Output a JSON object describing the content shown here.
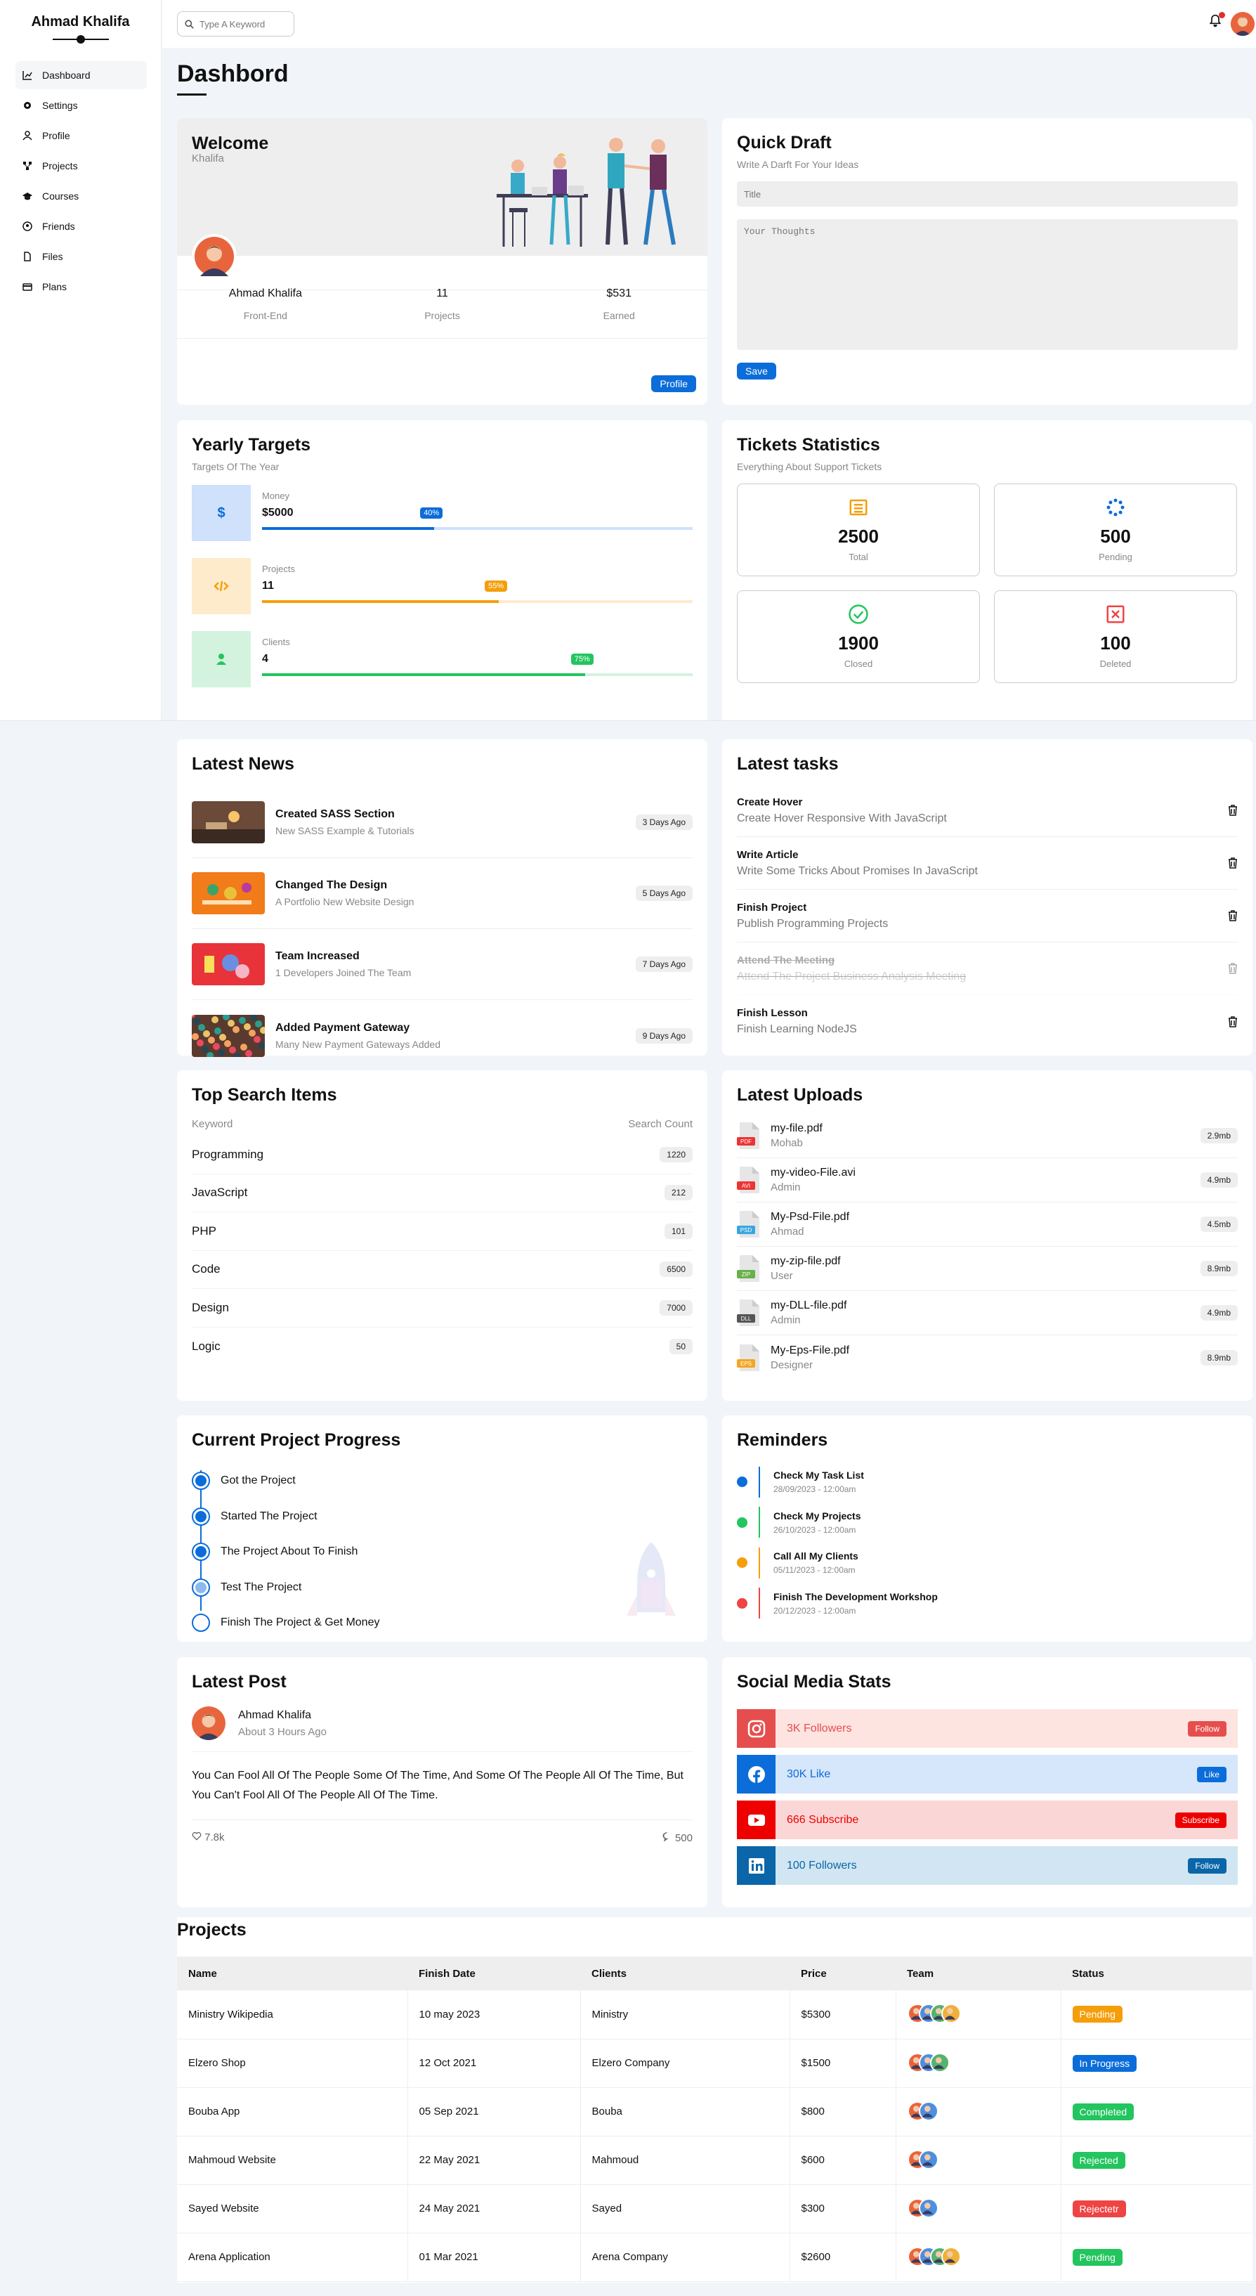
{
  "sidebar": {
    "brand": "Ahmad Khalifa",
    "items": [
      {
        "label": "Dashboard",
        "icon": "chart-icon"
      },
      {
        "label": "Settings",
        "icon": "gear-icon"
      },
      {
        "label": "Profile",
        "icon": "user-icon"
      },
      {
        "label": "Projects",
        "icon": "diagram-icon"
      },
      {
        "label": "Courses",
        "icon": "graduation-cap-icon"
      },
      {
        "label": "Friends",
        "icon": "circle-user-icon"
      },
      {
        "label": "Files",
        "icon": "file-icon"
      },
      {
        "label": "Plans",
        "icon": "credit-card-icon"
      }
    ]
  },
  "topbar": {
    "search_placeholder": "Type A Keyword"
  },
  "page": {
    "title": "Dashbord"
  },
  "welcome": {
    "title": "Welcome",
    "name": "Khalifa",
    "stats": [
      {
        "value": "Ahmad Khalifa",
        "label": "Front-End"
      },
      {
        "value": "11",
        "label": "Projects"
      },
      {
        "value": "$531",
        "label": "Earned"
      }
    ],
    "button": "Profile"
  },
  "draft": {
    "title": "Quick Draft",
    "subtitle": "Write A Darft For Your Ideas",
    "title_placeholder": "Title",
    "body_placeholder": "Your Thoughts",
    "button": "Save"
  },
  "targets": {
    "title": "Yearly Targets",
    "subtitle": "Targets Of The Year",
    "items": [
      {
        "label": "Money",
        "value": "$5000",
        "percent": 40,
        "percent_label": "40%",
        "color": "#0b6dd9",
        "bg": "#cfe1fb",
        "icon": "dollar-icon"
      },
      {
        "label": "Projects",
        "value": "11",
        "percent": 55,
        "percent_label": "55%",
        "color": "#f59e0b",
        "bg": "#fdebcc",
        "icon": "code-icon"
      },
      {
        "label": "Clients",
        "value": "4",
        "percent": 75,
        "percent_label": "75%",
        "color": "#22c55e",
        "bg": "#d3f3df",
        "icon": "user-icon"
      }
    ]
  },
  "tickets": {
    "title": "Tickets Statistics",
    "subtitle": "Everything About Support Tickets",
    "items": [
      {
        "value": "2500",
        "label": "Total",
        "icon": "list-icon",
        "color": "#f59e0b"
      },
      {
        "value": "500",
        "label": "Pending",
        "icon": "spinner-icon",
        "color": "#0b6dd9"
      },
      {
        "value": "1900",
        "label": "Closed",
        "icon": "check-circle-icon",
        "color": "#22c55e"
      },
      {
        "value": "100",
        "label": "Deleted",
        "icon": "x-square-icon",
        "color": "#ef4444"
      }
    ]
  },
  "news": {
    "title": "Latest News",
    "items": [
      {
        "title": "Created SASS Section",
        "desc": "New SASS Example & Tutorials",
        "time": "3 Days Ago"
      },
      {
        "title": "Changed The Design",
        "desc": "A Portfolio New Website Design",
        "time": "5 Days Ago"
      },
      {
        "title": "Team Increased",
        "desc": "1 Developers Joined The Team",
        "time": "7 Days Ago"
      },
      {
        "title": "Added Payment Gateway",
        "desc": "Many New Payment Gateways Added",
        "time": "9 Days Ago"
      }
    ]
  },
  "tasks": {
    "title": "Latest tasks",
    "items": [
      {
        "title": "Create Hover",
        "desc": "Create Hover Responsive With JavaScript",
        "done": false
      },
      {
        "title": "Write Article",
        "desc": "Write Some Tricks About Promises In JavaScript",
        "done": false
      },
      {
        "title": "Finish Project",
        "desc": "Publish Programming Projects",
        "done": false
      },
      {
        "title": "Attend The Meeting",
        "desc": "Attend The Project Business Analysis Meeting",
        "done": true
      },
      {
        "title": "Finish Lesson",
        "desc": "Finish Learning NodeJS",
        "done": false
      }
    ]
  },
  "search": {
    "title": "Top Search Items",
    "col1": "Keyword",
    "col2": "Search Count",
    "items": [
      {
        "k": "Programming",
        "v": "1220"
      },
      {
        "k": "JavaScript",
        "v": "212"
      },
      {
        "k": "PHP",
        "v": "101"
      },
      {
        "k": "Code",
        "v": "6500"
      },
      {
        "k": "Design",
        "v": "7000"
      },
      {
        "k": "Logic",
        "v": "50"
      }
    ]
  },
  "uploads": {
    "title": "Latest Uploads",
    "items": [
      {
        "name": "my-file.pdf",
        "user": "Mohab",
        "size": "2.9mb",
        "ext": "PDF",
        "color": "#e33"
      },
      {
        "name": "my-video-File.avi",
        "user": "Admin",
        "size": "4.9mb",
        "ext": "AVI",
        "color": "#e33"
      },
      {
        "name": "My-Psd-File.pdf",
        "user": "Ahmad",
        "size": "4.5mb",
        "ext": "PSD",
        "color": "#3aa6e0"
      },
      {
        "name": "my-zip-file.pdf",
        "user": "User",
        "size": "8.9mb",
        "ext": "ZIP",
        "color": "#6ab04c"
      },
      {
        "name": "my-DLL-file.pdf",
        "user": "Admin",
        "size": "4.9mb",
        "ext": "DLL",
        "color": "#555"
      },
      {
        "name": "My-Eps-File.pdf",
        "user": "Designer",
        "size": "8.9mb",
        "ext": "EPS",
        "color": "#f5a623"
      }
    ]
  },
  "progress": {
    "title": "Current Project Progress",
    "items": [
      {
        "label": "Got the Project",
        "state": "done"
      },
      {
        "label": "Started The Project",
        "state": "done"
      },
      {
        "label": "The Project About To Finish",
        "state": "done"
      },
      {
        "label": "Test The Project",
        "state": "current"
      },
      {
        "label": "Finish The Project & Get Money",
        "state": "todo"
      }
    ]
  },
  "reminders": {
    "title": "Reminders",
    "items": [
      {
        "title": "Check My Task List",
        "date": "28/09/2023 - 12:00am",
        "color": "#0b6dd9"
      },
      {
        "title": "Check My Projects",
        "date": "26/10/2023 - 12:00am",
        "color": "#22c55e"
      },
      {
        "title": "Call All My Clients",
        "date": "05/11/2023 - 12:00am",
        "color": "#f59e0b"
      },
      {
        "title": "Finish The Development Workshop",
        "date": "20/12/2023 - 12:00am",
        "color": "#ef4444"
      }
    ]
  },
  "post": {
    "title": "Latest Post",
    "author": "Ahmad Khalifa",
    "time": "About 3 Hours Ago",
    "text": "You Can Fool All Of The People Some Of The Time, And Some Of The People All Of The Time, But You Can't Fool All Of The People All Of The Time.",
    "likes": "7.8k",
    "comments": "500"
  },
  "social": {
    "title": "Social Media Stats",
    "items": [
      {
        "text": "3K Followers",
        "btn": "Follow",
        "icon": "instagram-icon",
        "main": "#e64e4e",
        "bg": "#fde4e0",
        "btnbg": "#e64e4e"
      },
      {
        "text": "30K Like",
        "btn": "Like",
        "icon": "facebook-icon",
        "main": "#0b6dd9",
        "bg": "#d6e6fb",
        "btnbg": "#0b6dd9"
      },
      {
        "text": "666 Subscribe",
        "btn": "Subscribe",
        "icon": "youtube-icon",
        "main": "#e00",
        "bg": "#fbd6d6",
        "btnbg": "#e00"
      },
      {
        "text": "100 Followers",
        "btn": "Follow",
        "icon": "linkedin-icon",
        "main": "#0a66a8",
        "bg": "#d1e6f2",
        "btnbg": "#0a66a8"
      }
    ]
  },
  "projects": {
    "title": "Projects",
    "headers": [
      "Name",
      "Finish Date",
      "Clients",
      "Price",
      "Team",
      "Status"
    ],
    "rows": [
      {
        "name": "Ministry Wikipedia",
        "date": "10 may 2023",
        "client": "Ministry",
        "price": "$5300",
        "team": 4,
        "status": "Pending",
        "color": "#f59e0b"
      },
      {
        "name": "Elzero Shop",
        "date": "12 Oct 2021",
        "client": "Elzero Company",
        "price": "$1500",
        "team": 3,
        "status": "In Progress",
        "color": "#0b6dd9"
      },
      {
        "name": "Bouba App",
        "date": "05 Sep 2021",
        "client": "Bouba",
        "price": "$800",
        "team": 2,
        "status": "Completed",
        "color": "#22c55e"
      },
      {
        "name": "Mahmoud Website",
        "date": "22 May 2021",
        "client": "Mahmoud",
        "price": "$600",
        "team": 2,
        "status": "Rejected",
        "color": "#22c55e"
      },
      {
        "name": "Sayed Website",
        "date": "24 May 2021",
        "client": "Sayed",
        "price": "$300",
        "team": 2,
        "status": "Rejectetr",
        "color": "#ef4444"
      },
      {
        "name": "Arena Application",
        "date": "01 Mar 2021",
        "client": "Arena Company",
        "price": "$2600",
        "team": 4,
        "status": "Pending",
        "color": "#22c55e"
      }
    ]
  }
}
